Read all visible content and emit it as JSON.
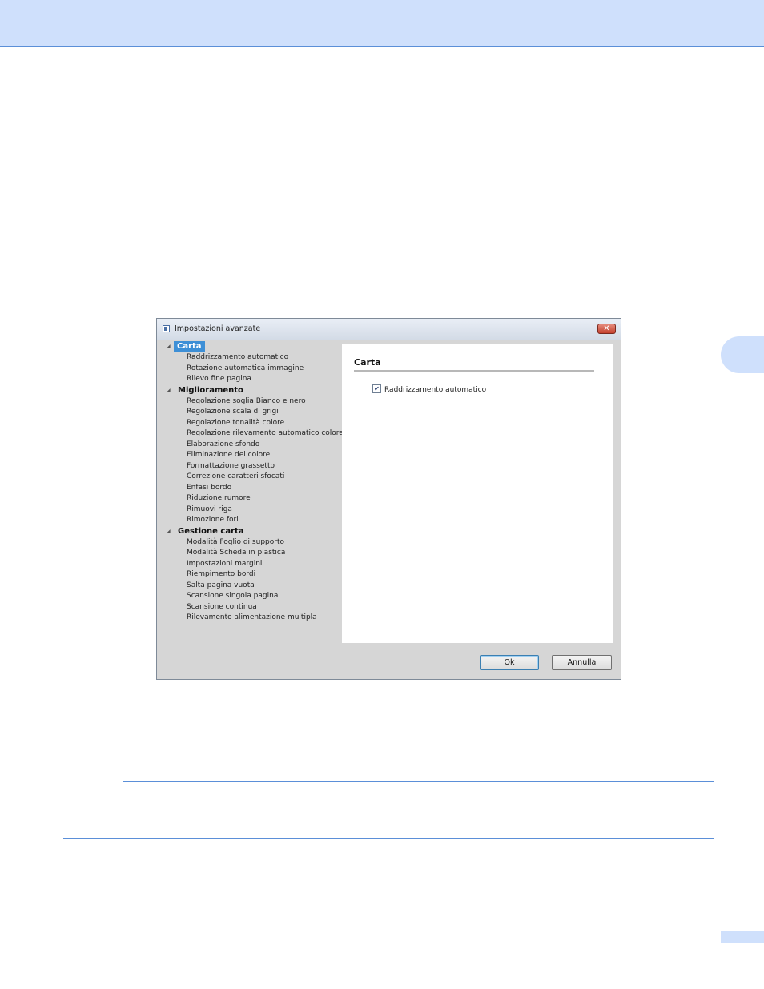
{
  "dialog": {
    "title": "Impostazioni avanzate",
    "close_glyph": "✕",
    "tree": [
      {
        "label": "Carta",
        "selected": true,
        "items": [
          "Raddrizzamento automatico",
          "Rotazione automatica immagine",
          "Rilevo fine pagina"
        ]
      },
      {
        "label": "Miglioramento",
        "selected": false,
        "items": [
          "Regolazione soglia Bianco e nero",
          "Regolazione scala di grigi",
          "Regolazione tonalità colore",
          "Regolazione rilevamento automatico colore",
          "Elaborazione sfondo",
          "Eliminazione del colore",
          "Formattazione grassetto",
          "Correzione caratteri sfocati",
          "Enfasi bordo",
          "Riduzione rumore",
          "Rimuovi riga",
          "Rimozione fori"
        ]
      },
      {
        "label": "Gestione carta",
        "selected": false,
        "items": [
          "Modalità Foglio di supporto",
          "Modalità Scheda in plastica",
          "Impostazioni margini",
          "Riempimento bordi",
          "Salta pagina vuota",
          "Scansione singola pagina",
          "Scansione continua",
          "Rilevamento alimentazione multipla"
        ]
      }
    ],
    "content": {
      "heading": "Carta",
      "checkbox_label": "Raddrizzamento automatico",
      "checkbox_checked": true
    },
    "buttons": {
      "ok": "Ok",
      "cancel": "Annulla"
    }
  },
  "colors": {
    "header_band": "#cfe0fc",
    "rule": "#5b8fd8",
    "selection": "#3d8fd6"
  }
}
